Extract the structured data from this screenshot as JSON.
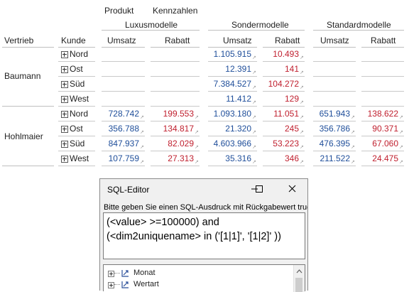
{
  "pivot": {
    "top_labels": {
      "produkt": "Produkt",
      "kennzahlen": "Kennzahlen"
    },
    "groups": [
      "Luxusmodelle",
      "Sondermodelle",
      "Standardmodelle"
    ],
    "row_headers": {
      "vertrieb": "Vertrieb",
      "kunde": "Kunde"
    },
    "measures": [
      "Umsatz",
      "Rabatt",
      "Umsatz",
      "Rabatt",
      "Umsatz",
      "Rabatt"
    ],
    "salespersons": [
      "Baumann",
      "Hohlmaier"
    ],
    "regions": [
      "Nord",
      "Ost",
      "Süd",
      "West"
    ],
    "rows": [
      {
        "kunde": "Nord",
        "cells": [
          "",
          "",
          "1.105.915",
          "10.493",
          "",
          ""
        ]
      },
      {
        "kunde": "Ost",
        "cells": [
          "",
          "",
          "12.391",
          "141",
          "",
          ""
        ]
      },
      {
        "kunde": "Süd",
        "cells": [
          "",
          "",
          "7.384.527",
          "104.272",
          "",
          ""
        ]
      },
      {
        "kunde": "West",
        "cells": [
          "",
          "",
          "11.412",
          "129",
          "",
          ""
        ]
      },
      {
        "kunde": "Nord",
        "cells": [
          "728.742",
          "199.553",
          "1.093.180",
          "11.051",
          "651.943",
          "138.622"
        ]
      },
      {
        "kunde": "Ost",
        "cells": [
          "356.788",
          "134.817",
          "21.320",
          "245",
          "356.786",
          "90.371"
        ]
      },
      {
        "kunde": "Süd",
        "cells": [
          "847.937",
          "82.029",
          "4.603.966",
          "53.223",
          "476.395",
          "67.060"
        ]
      },
      {
        "kunde": "West",
        "cells": [
          "107.759",
          "27.313",
          "35.316",
          "346",
          "211.522",
          "24.475"
        ]
      }
    ],
    "colors": {
      "umsatz": "#1f4e9a",
      "rabatt": "#c0202f"
    }
  },
  "dialog": {
    "title": "SQL-Editor",
    "controls": [
      "minimize-icon",
      "maximize-icon",
      "close-icon"
    ],
    "hint": "Bitte geben Sie einen SQL-Ausdruck mit Rückgabewert true",
    "expression_line1": "(<value> >=100000) and",
    "expression_line2": "(<dim2uniquename> in ('[1|1]', '[1|2]' ))",
    "tree_items": [
      "Monat",
      "Wertart"
    ]
  }
}
